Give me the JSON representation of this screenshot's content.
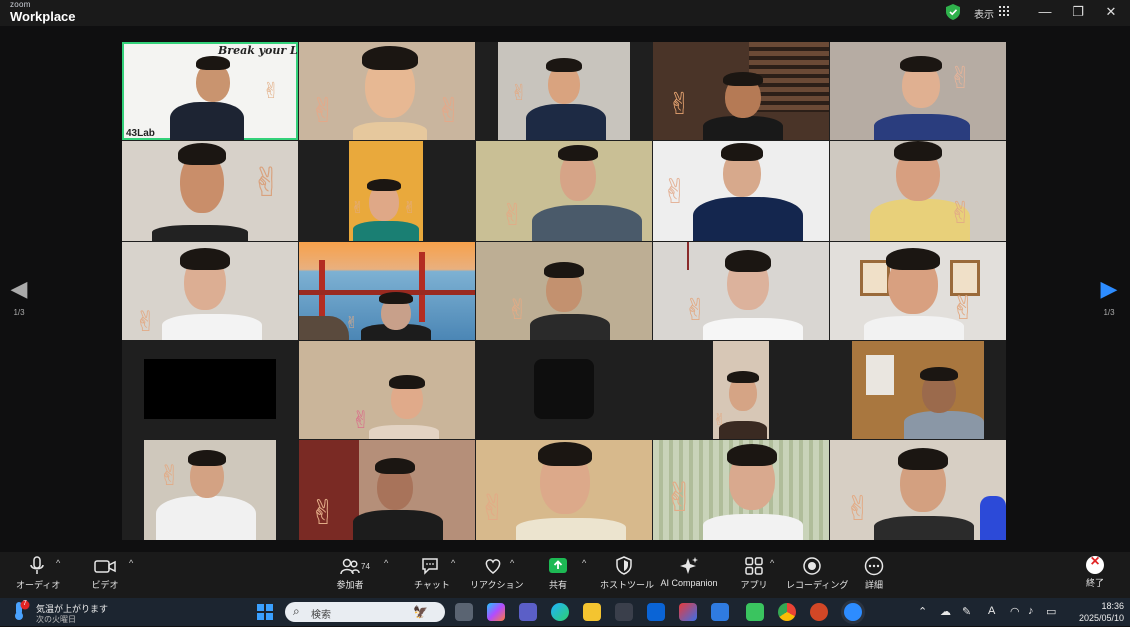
{
  "app": {
    "brand_small": "zoom",
    "brand_large": "Workplace"
  },
  "titlebar": {
    "view_label": "表示",
    "minimize": "—",
    "maximize": "❐",
    "close": "✕"
  },
  "gallery": {
    "slogan": "Break your Limit",
    "logo_text": "43Lab",
    "page_indicator_left": "1/3",
    "page_indicator_right": "1/3",
    "prev_arrow": "◀",
    "next_arrow": "▶"
  },
  "toolbar": {
    "audio": "オーディオ",
    "video": "ビデオ",
    "participants": "参加者",
    "participants_count": "74",
    "chat": "チャット",
    "reactions": "リアクション",
    "share": "共有",
    "host_tools": "ホストツール",
    "ai_companion": "AI Companion",
    "apps": "アプリ",
    "recording": "レコーディング",
    "details": "詳細",
    "end": "終了",
    "caret": "^"
  },
  "taskbar": {
    "weather_line1": "気温が上がります",
    "weather_line2": "次の火曜日",
    "weather_badge": "7",
    "search_placeholder": "検索",
    "ime": "A",
    "time": "18:36",
    "date": "2025/05/10"
  },
  "colors": {
    "active_border": "#33d17a",
    "share_green": "#1db954",
    "next_arrow": "#2d8cff",
    "end_red": "#e02424"
  }
}
